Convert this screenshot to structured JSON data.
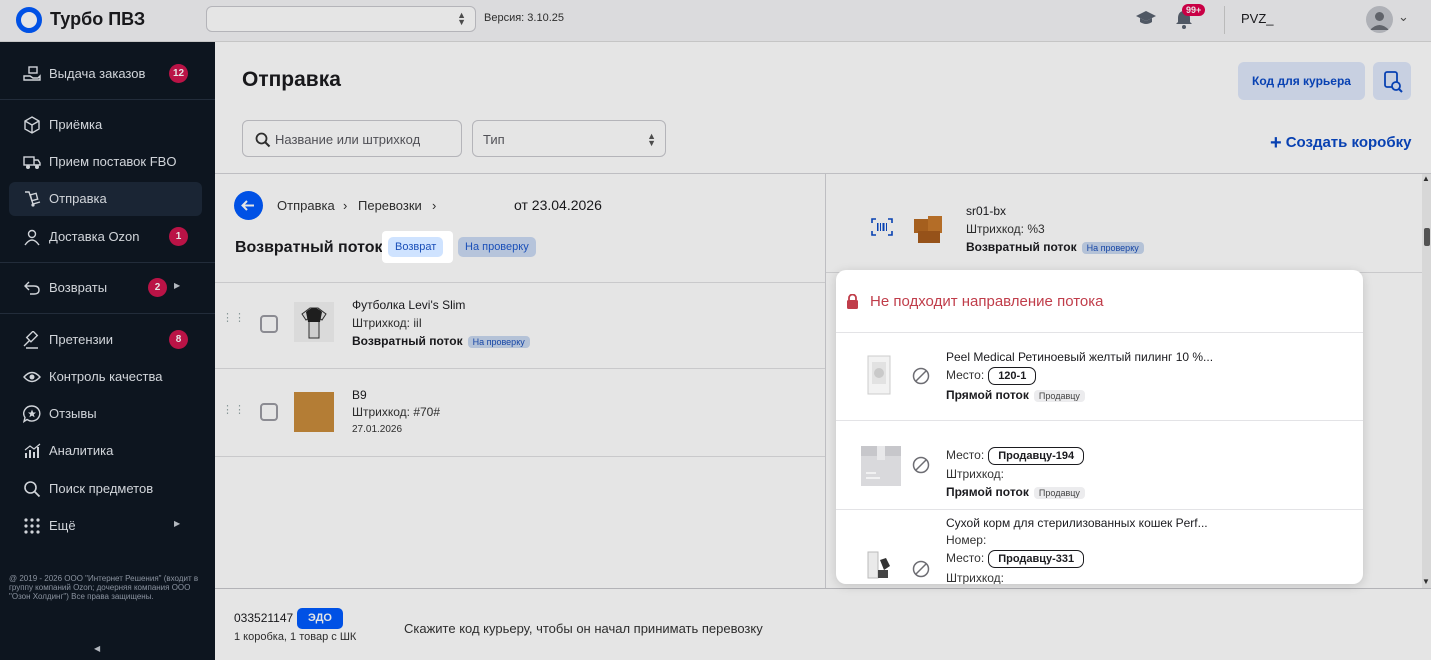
{
  "app": {
    "name": "Турбо ПВЗ",
    "version": "Версия: 3.10.25",
    "user": "PVZ_",
    "notifications": "99+"
  },
  "sidebar": {
    "items": [
      {
        "label": "Выдача заказов",
        "badge": "12"
      },
      {
        "label": "Приёмка"
      },
      {
        "label": "Прием поставок FBO"
      },
      {
        "label": "Отправка"
      },
      {
        "label": "Доставка Ozon",
        "badge": "1"
      },
      {
        "label": "Возвраты",
        "badge": "2"
      },
      {
        "label": "Претензии",
        "badge": "8"
      },
      {
        "label": "Контроль качества"
      },
      {
        "label": "Отзывы"
      },
      {
        "label": "Аналитика"
      },
      {
        "label": "Поиск предметов"
      },
      {
        "label": "Ещё"
      }
    ],
    "copyright": "@ 2019 - 2026 ООО \"Интернет Решения\" (входит в группу компаний Ozon; дочерняя компания ООО \"Озон Холдинг\") Все права защищены."
  },
  "page": {
    "title": "Отправка",
    "courier_button": "Код для курьера",
    "search_placeholder": "Название или штрихкод",
    "type_placeholder": "Тип",
    "create_box": "Создать коробку"
  },
  "breadcrumb": {
    "items": [
      "Отправка",
      "Перевозки"
    ],
    "date": "от 23.04.2026"
  },
  "flow": {
    "title": "Возвратный поток",
    "chip_return": "Возврат",
    "chip_check": "На проверку"
  },
  "items": [
    {
      "name": "Футболка Levi's Slim",
      "barcode": "Штрихкод: ііІ",
      "flow": "Возвратный поток",
      "chip": "На проверку"
    },
    {
      "name": "B9",
      "barcode": "Штрихкод: #70#",
      "date": "27.01.2026"
    }
  ],
  "right_item": {
    "name": "sr01-bx",
    "barcode": "Штрихкод: %3",
    "flow": "Возвратный поток",
    "chip": "На проверку"
  },
  "popover": {
    "title": "Не подходит направление потока",
    "items": [
      {
        "name": "Peel Medical Ретиноевый желтый пилинг 10 %...",
        "place_label": "Место:",
        "place": "120-1",
        "flow": "Прямой поток",
        "chip": "Продавцу"
      },
      {
        "place_label": "Место:",
        "place": "Продавцу-194",
        "barcode": "Штрихкод:",
        "flow": "Прямой поток",
        "chip": "Продавцу"
      },
      {
        "name": "Сухой корм для стерилизованных кошек Perf...",
        "number": "Номер:",
        "place_label": "Место:",
        "place": "Продавцу-331",
        "barcode": "Штрихкод:"
      }
    ]
  },
  "bottom": {
    "number": "033521147",
    "edo": "ЭДО",
    "summary": "1 коробка, 1 товар с ШК",
    "message": "Скажите код курьеру, чтобы он начал принимать перевозку"
  },
  "colors": {
    "accent": "#005bff",
    "sidebar_bg": "#0f1823",
    "badge": "#d0164f",
    "error": "#c03d4a"
  }
}
